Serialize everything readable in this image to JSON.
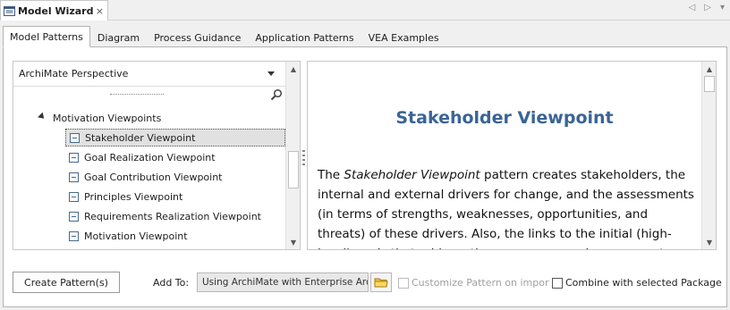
{
  "window": {
    "title": "Model Wizard",
    "close_glyph": "×",
    "nav_prev": "◁",
    "nav_next": "▷",
    "nav_dropdown": "▾"
  },
  "tabs": [
    {
      "label": "Model Patterns",
      "active": true
    },
    {
      "label": "Diagram",
      "active": false
    },
    {
      "label": "Process Guidance",
      "active": false
    },
    {
      "label": "Application Patterns",
      "active": false
    },
    {
      "label": "VEA Examples",
      "active": false
    }
  ],
  "perspective": {
    "selected": "ArchiMate Perspective"
  },
  "tree": {
    "group": "Motivation Viewpoints",
    "items": [
      {
        "label": "Stakeholder Viewpoint",
        "selected": true
      },
      {
        "label": "Goal Realization Viewpoint",
        "selected": false
      },
      {
        "label": "Goal Contribution Viewpoint",
        "selected": false
      },
      {
        "label": "Principles Viewpoint",
        "selected": false
      },
      {
        "label": "Requirements Realization Viewpoint",
        "selected": false
      },
      {
        "label": "Motivation Viewpoint",
        "selected": false
      }
    ]
  },
  "description": {
    "title": "Stakeholder Viewpoint",
    "intro": "The ",
    "emph": "Stakeholder Viewpoint",
    "body": " pattern creates stakeholders, the internal and external drivers for change, and the assessments (in terms of strengths, weaknesses, opportunities, and threats) of these drivers. Also, the links to the initial (high-level) goals that address these concerns and assessments are also described. These"
  },
  "footer": {
    "create_label": "Create Pattern(s)",
    "add_to_label": "Add To:",
    "add_to_value": "Using ArchiMate with Enterprise Architect",
    "customize_label": "Customize Pattern on import",
    "combine_label": "Combine with selected Package"
  },
  "colors": {
    "title_blue": "#3a6496",
    "selection_bg": "#e1e1e1"
  }
}
